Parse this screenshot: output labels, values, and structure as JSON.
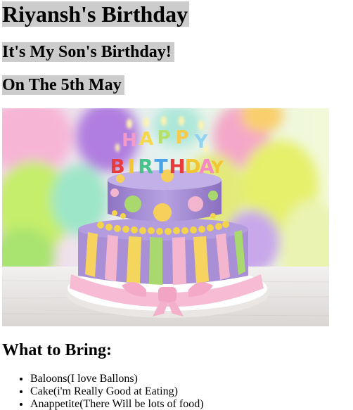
{
  "headings": {
    "title": "Riyansh's Birthday",
    "subtitle": "It's My Son's Birthday!",
    "date": "On The 5th May"
  },
  "photo": {
    "candle_letters_top": [
      "H",
      "A",
      "P",
      "P",
      "Y"
    ],
    "candle_letters_bottom": [
      "B",
      "I",
      "R",
      "T",
      "H",
      "D",
      "A",
      "Y"
    ]
  },
  "bring": {
    "heading": "What to Bring:",
    "items": [
      "Baloons(I love Ballons)",
      "Cake(i'm Really Good at Eating)",
      "Anappetite(There Will be lots of food)"
    ]
  },
  "colors": {
    "heading_highlight": "#cccccc",
    "cake_purple": "#a98fd6",
    "cake_pink": "#f4b6cf"
  }
}
